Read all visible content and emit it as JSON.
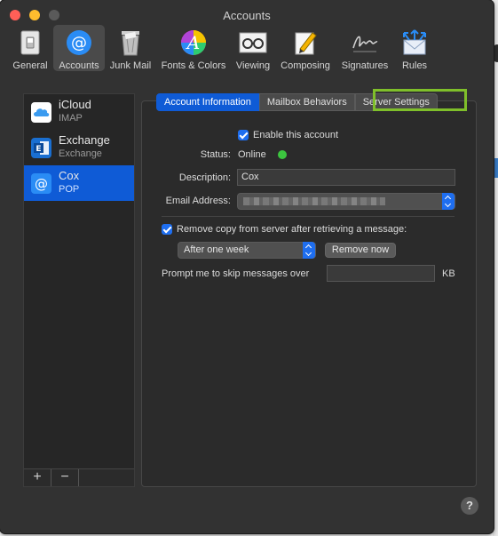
{
  "window": {
    "title": "Accounts"
  },
  "toolbar": {
    "items": [
      {
        "label": "General",
        "icon": "switch-icon"
      },
      {
        "label": "Accounts",
        "icon": "at-sign-icon"
      },
      {
        "label": "Junk Mail",
        "icon": "trash-can-icon"
      },
      {
        "label": "Fonts & Colors",
        "icon": "color-wheel-font-icon"
      },
      {
        "label": "Viewing",
        "icon": "glasses-icon"
      },
      {
        "label": "Composing",
        "icon": "pencil-paper-icon"
      },
      {
        "label": "Signatures",
        "icon": "signature-icon"
      },
      {
        "label": "Rules",
        "icon": "rules-envelope-icon"
      }
    ],
    "selected": "Accounts"
  },
  "accounts": [
    {
      "name": "iCloud",
      "type": "IMAP",
      "icon": "icloud-icon"
    },
    {
      "name": "Exchange",
      "type": "Exchange",
      "icon": "exchange-icon"
    },
    {
      "name": "Cox",
      "type": "POP",
      "icon": "at-sign-icon"
    }
  ],
  "selected_account": "Cox",
  "sidebar_buttons": {
    "add": "+",
    "remove": "−"
  },
  "tabs": {
    "account_information": "Account Information",
    "mailbox_behaviors": "Mailbox Behaviors",
    "server_settings": "Server Settings",
    "selected": "Account Information",
    "highlighted": "Server Settings"
  },
  "form": {
    "enable_label": "Enable this account",
    "enable_checked": true,
    "status_label": "Status:",
    "status_value": "Online",
    "description_label": "Description:",
    "description_value": "Cox",
    "email_label": "Email Address:",
    "remove_copy_label": "Remove copy from server after retrieving a message:",
    "remove_copy_checked": true,
    "remove_period": "After one week",
    "remove_now_button": "Remove now",
    "prompt_label": "Prompt me to skip messages over",
    "prompt_value": "",
    "prompt_unit": "KB"
  },
  "help_button": "?",
  "colors": {
    "accent": "#0f5bd6",
    "highlight": "#7fbf2a",
    "online": "#3cc53f",
    "close": "#ff5f57",
    "minimize": "#febc2e"
  }
}
